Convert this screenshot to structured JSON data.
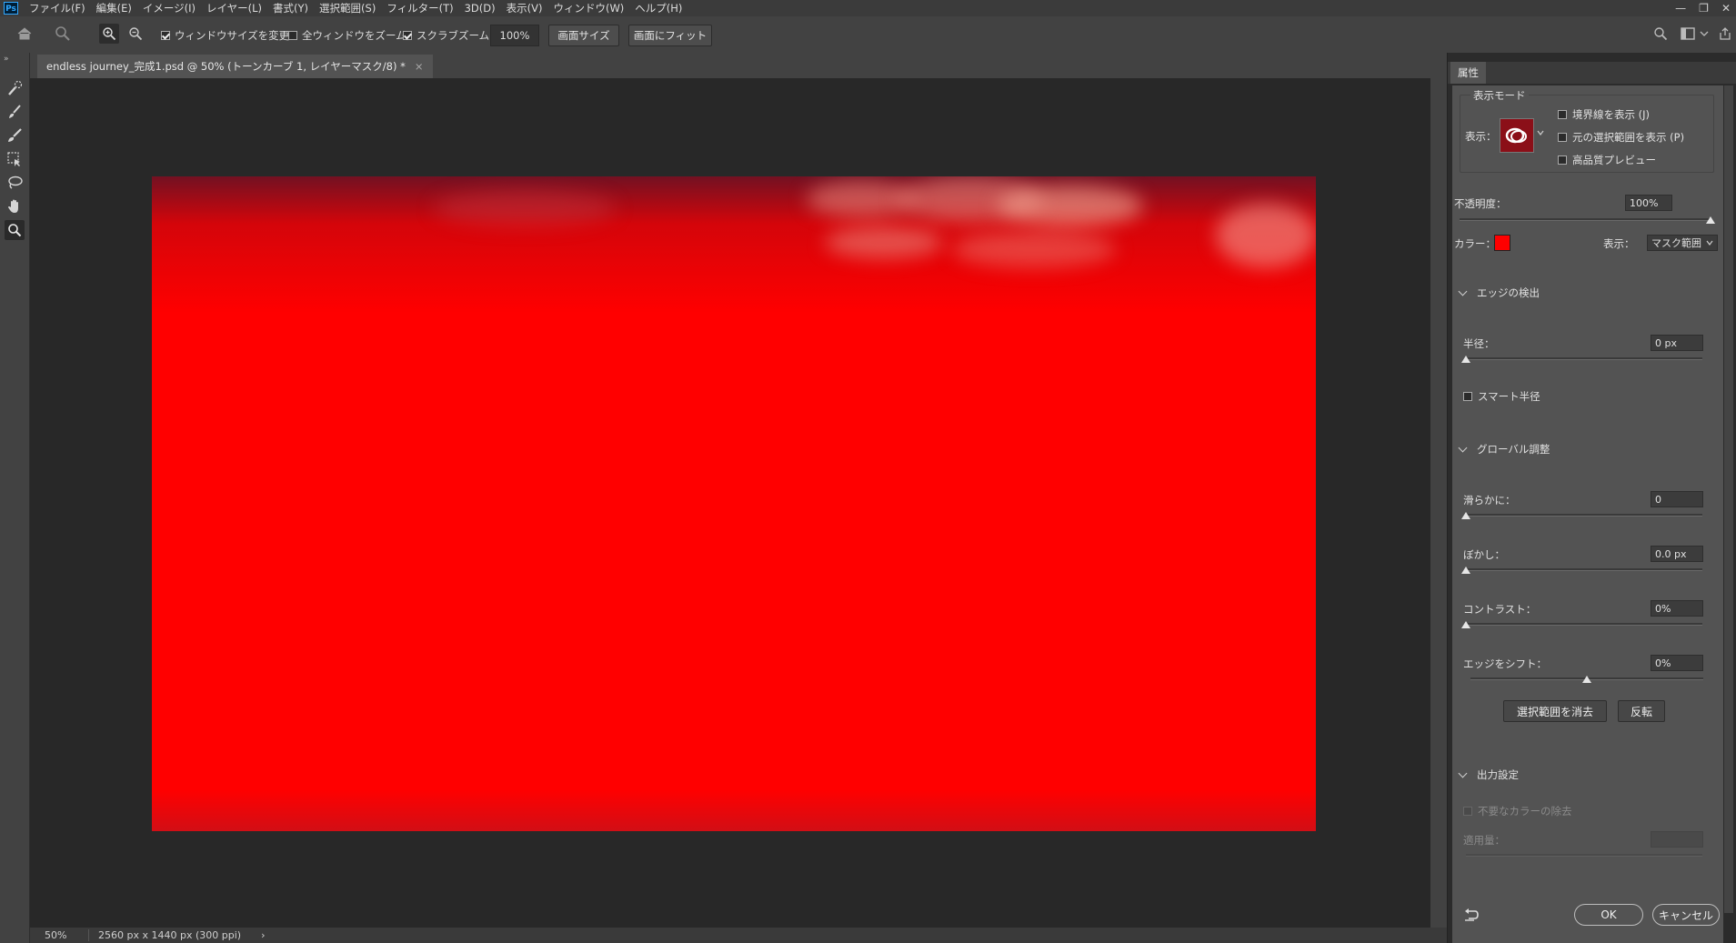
{
  "menu": {
    "logo": "Ps",
    "items": [
      "ファイル(F)",
      "編集(E)",
      "イメージ(I)",
      "レイヤー(L)",
      "書式(Y)",
      "選択範囲(S)",
      "フィルター(T)",
      "3D(D)",
      "表示(V)",
      "ウィンドウ(W)",
      "ヘルプ(H)"
    ],
    "controls": [
      "—",
      "❐",
      "✕"
    ]
  },
  "options": {
    "resize_windows": "ウィンドウサイズを変更",
    "zoom_all": "全ウィンドウをズーム",
    "scrubby_zoom": "スクラブズーム",
    "zoom_value": "100%",
    "screen_size_btn": "画面サイズ",
    "fit_screen_btn": "画面にフィット"
  },
  "document": {
    "tab_title": "endless journey_完成1.psd @ 50% (トーンカーブ 1, レイヤーマスク/8) *",
    "close": "×"
  },
  "status": {
    "zoom": "50%",
    "dimensions": "2560 px x 1440 px (300 ppi)",
    "arrow": "›"
  },
  "panel": {
    "tab": "属性",
    "view_mode": {
      "title": "表示モード",
      "view_label": "表示：",
      "show_edge": "境界線を表示 (J)",
      "show_original": "元の選択範囲を表示 (P)",
      "hq_preview": "高品質プレビュー"
    },
    "opacity_label": "不透明度：",
    "opacity_value": "100%",
    "opacity_level": 1.0,
    "color_label": "カラー：",
    "mask_color": "#ff0000",
    "display_label": "表示：",
    "display_value": "マスク範囲",
    "edge_detection": {
      "title": "エッジの検出",
      "radius_label": "半径：",
      "radius_value": "0 px",
      "smart_radius": "スマート半径"
    },
    "global": {
      "title": "グローバル調整",
      "smooth_label": "滑らかに：",
      "smooth_value": "0",
      "feather_label": "ぼかし：",
      "feather_value": "0.0 px",
      "contrast_label": "コントラスト：",
      "contrast_value": "0%",
      "shift_label": "エッジをシフト：",
      "shift_value": "0%",
      "clear_btn": "選択範囲を消去",
      "invert_btn": "反転"
    },
    "output": {
      "title": "出力設定",
      "decontaminate": "不要なカラーの除去",
      "amount_label": "適用量："
    },
    "ok_btn": "OK",
    "cancel_btn": "キャンセル"
  }
}
